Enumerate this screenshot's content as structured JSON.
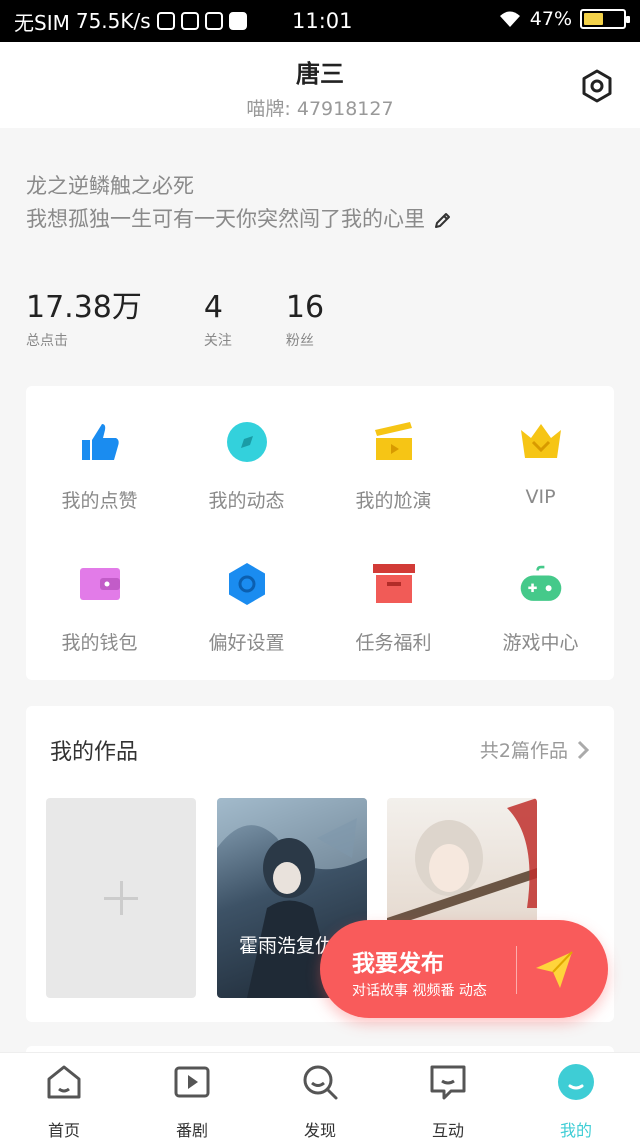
{
  "status_bar": {
    "carrier": "无SIM",
    "speed": "75.5K/s",
    "time": "11:01",
    "battery": "47%"
  },
  "header": {
    "name": "唐三",
    "uid": "喵牌: 47918127",
    "settings_icon": "hexagon-settings-icon"
  },
  "bio": {
    "line1": "龙之逆鳞触之必死",
    "line2": "我想孤独一生可有一天你突然闯了我的心里",
    "edit_icon": "pencil-icon"
  },
  "stats": [
    {
      "value": "17.38万",
      "label": "总点击"
    },
    {
      "value": "4",
      "label": "关注"
    },
    {
      "value": "16",
      "label": "粉丝"
    }
  ],
  "grid": [
    {
      "label": "我的点赞",
      "icon": "thumbs-up-icon",
      "color": "#1a8cf0"
    },
    {
      "label": "我的动态",
      "icon": "compass-icon",
      "color": "#33d1dc"
    },
    {
      "label": "我的尬演",
      "icon": "clapperboard-icon",
      "color": "#f6c515"
    },
    {
      "label": "VIP",
      "icon": "crown-icon",
      "color": "#f6c515"
    },
    {
      "label": "我的钱包",
      "icon": "wallet-icon",
      "color": "#e27be8"
    },
    {
      "label": "偏好设置",
      "icon": "hexagon-gear-icon",
      "color": "#1a8cf0"
    },
    {
      "label": "任务福利",
      "icon": "gift-box-icon",
      "color": "#f15b57"
    },
    {
      "label": "游戏中心",
      "icon": "gamepad-icon",
      "color": "#45c98a"
    }
  ],
  "works": {
    "title": "我的作品",
    "count": "共2篇作品",
    "items": [
      {
        "title": "霍雨浩复仇"
      },
      {
        "title": ""
      }
    ]
  },
  "publish": {
    "title": "我要发布",
    "subtitle": "对话故事 视频番 动态"
  },
  "tabs": [
    {
      "label": "首页",
      "icon": "home-icon"
    },
    {
      "label": "番剧",
      "icon": "play-icon"
    },
    {
      "label": "发现",
      "icon": "discover-search-icon"
    },
    {
      "label": "互动",
      "icon": "chat-icon"
    },
    {
      "label": "我的",
      "icon": "profile-icon"
    }
  ],
  "colors": {
    "accent": "#3ecdd5",
    "publish": "#f95b5b"
  }
}
